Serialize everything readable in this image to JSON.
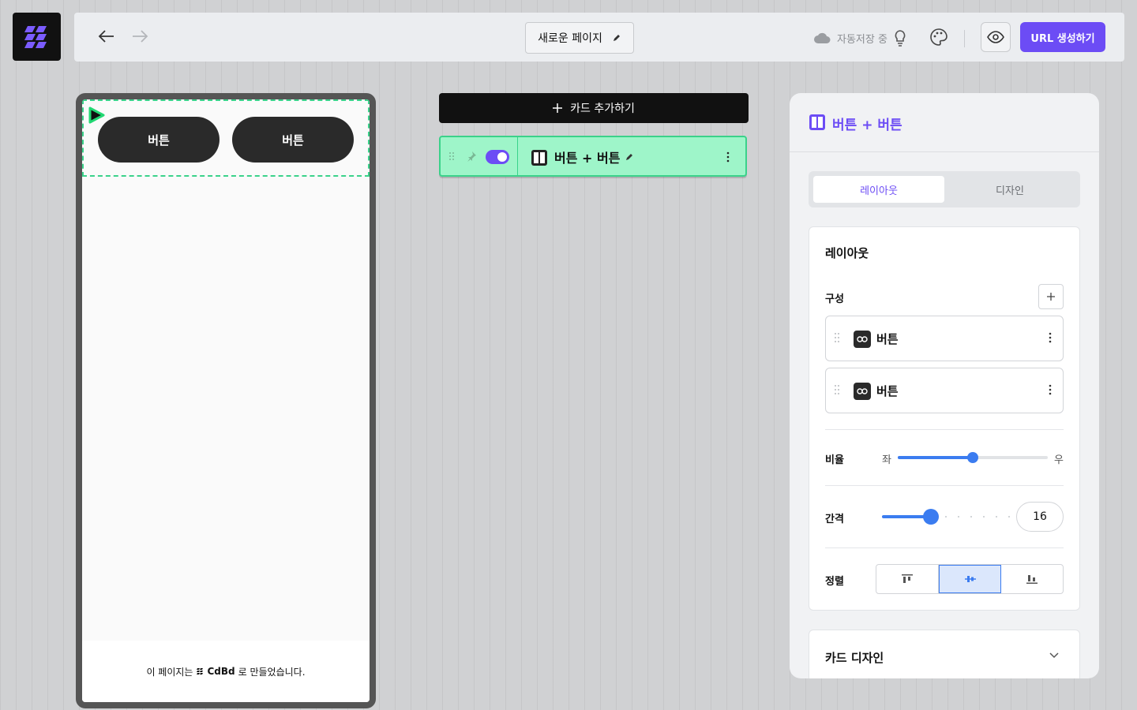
{
  "header": {
    "page_title": "새로운 페이지",
    "autosave_text": "자동저장 중",
    "url_button": "URL 생성하기"
  },
  "icons": [
    "logo-icon",
    "back-arrow-icon",
    "forward-arrow-icon",
    "pencil-icon",
    "cloud-icon",
    "lightbulb-icon",
    "palette-icon",
    "eye-icon",
    "play-icon",
    "plus-icon",
    "grip-icon",
    "pin-icon",
    "columns-icon",
    "more-icon",
    "link-icon",
    "chevron-down-icon",
    "align-top-icon",
    "align-middle-icon",
    "align-bottom-icon"
  ],
  "colors": {
    "accent": "#6c4cf5",
    "selection": "#3ad28a",
    "card_bg": "#9ef5c9",
    "slider": "#3b7cf0"
  },
  "preview": {
    "buttons": [
      "버튼",
      "버튼"
    ],
    "footer_prefix": "이 페이지는",
    "footer_brand": "CdBd",
    "footer_suffix": "로 만들었습니다."
  },
  "cards": {
    "add_label": "카드 추가하기",
    "items": [
      {
        "title": "버튼 + 버튼",
        "visible": true
      }
    ]
  },
  "panel": {
    "title": "버튼 + 버튼",
    "tabs": [
      {
        "label": "레이아웃",
        "active": true
      },
      {
        "label": "디자인",
        "active": false
      }
    ],
    "layout_section": {
      "title": "레이아웃",
      "composition_label": "구성",
      "items": [
        {
          "label": "버튼"
        },
        {
          "label": "버튼"
        }
      ],
      "ratio": {
        "label": "비율",
        "left": "좌",
        "right": "우",
        "value_fraction": 0.5
      },
      "gap": {
        "label": "간격",
        "value": "16"
      },
      "align": {
        "label": "정렬",
        "selected": "middle"
      }
    },
    "card_design_title": "카드 디자인"
  }
}
